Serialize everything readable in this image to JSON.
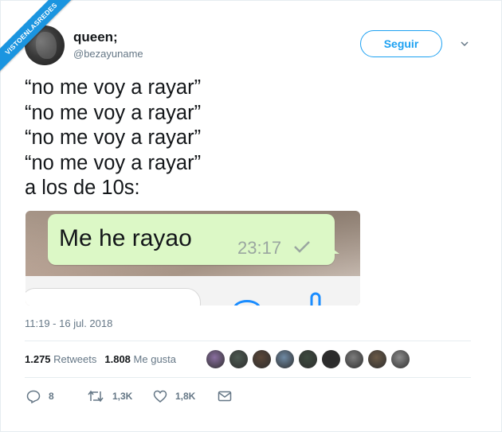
{
  "watermark": {
    "text": "VISTOENLASREDES"
  },
  "user": {
    "display_name": "queen;",
    "handle": "@bezayuname"
  },
  "follow_label": "Seguir",
  "tweet_lines": [
    "“no me voy a rayar”",
    "“no me voy a rayar”",
    "“no me voy a rayar”",
    "“no me voy a rayar”",
    "a los de 10s:"
  ],
  "media": {
    "message": "Me he rayao",
    "time": "23:17"
  },
  "timestamp": "11:19 - 16 jul. 2018",
  "stats": {
    "retweets_count": "1.275",
    "retweets_label": "Retweets",
    "likes_count": "1.808",
    "likes_label": "Me gusta"
  },
  "liker_colors": [
    "#8a6fa0",
    "#4d5a52",
    "#5a4638",
    "#6f8aa4",
    "#3d4a3f",
    "#2b2b2b",
    "#7d7d7d",
    "#6b5a47",
    "#8c8c8c",
    "#a39a7f"
  ],
  "actions": {
    "replies": "8",
    "retweets": "1,3K",
    "likes": "1,8K"
  },
  "colors": {
    "accent": "#1da1f2",
    "muted": "#657786",
    "bubble": "#dcf8c6"
  }
}
